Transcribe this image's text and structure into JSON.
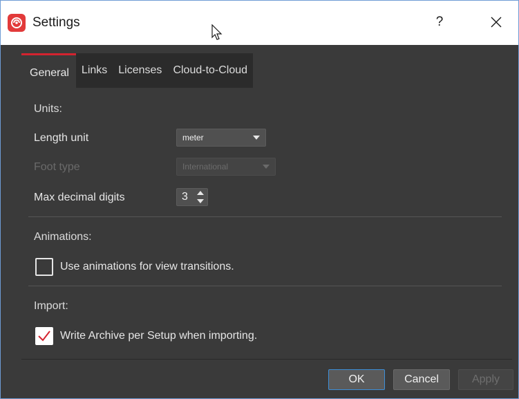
{
  "window": {
    "title": "Settings",
    "help_label": "?",
    "icon": "app-logo-icon",
    "close_icon": "close-icon"
  },
  "tabs": [
    {
      "label": "General",
      "active": true
    },
    {
      "label": "Links",
      "active": false
    },
    {
      "label": "Licenses",
      "active": false
    },
    {
      "label": "Cloud-to-Cloud",
      "active": false
    }
  ],
  "units": {
    "section_label": "Units:",
    "length_unit": {
      "label": "Length unit",
      "value": "meter"
    },
    "foot_type": {
      "label": "Foot type",
      "value": "International",
      "disabled": true
    },
    "max_decimal_digits": {
      "label": "Max decimal digits",
      "value": "3"
    }
  },
  "animations": {
    "section_label": "Animations:",
    "use_animations": {
      "label": "Use animations for view transitions.",
      "checked": false
    }
  },
  "import": {
    "section_label": "Import:",
    "write_archive": {
      "label": "Write Archive per Setup when importing.",
      "checked": true
    }
  },
  "buttons": {
    "ok": "OK",
    "cancel": "Cancel",
    "apply": "Apply"
  },
  "colors": {
    "accent": "#d4232f",
    "panel_bg": "#3a3a3a",
    "tabbar_bg": "#2b2b2b",
    "focus_border": "#3d8fd8"
  }
}
